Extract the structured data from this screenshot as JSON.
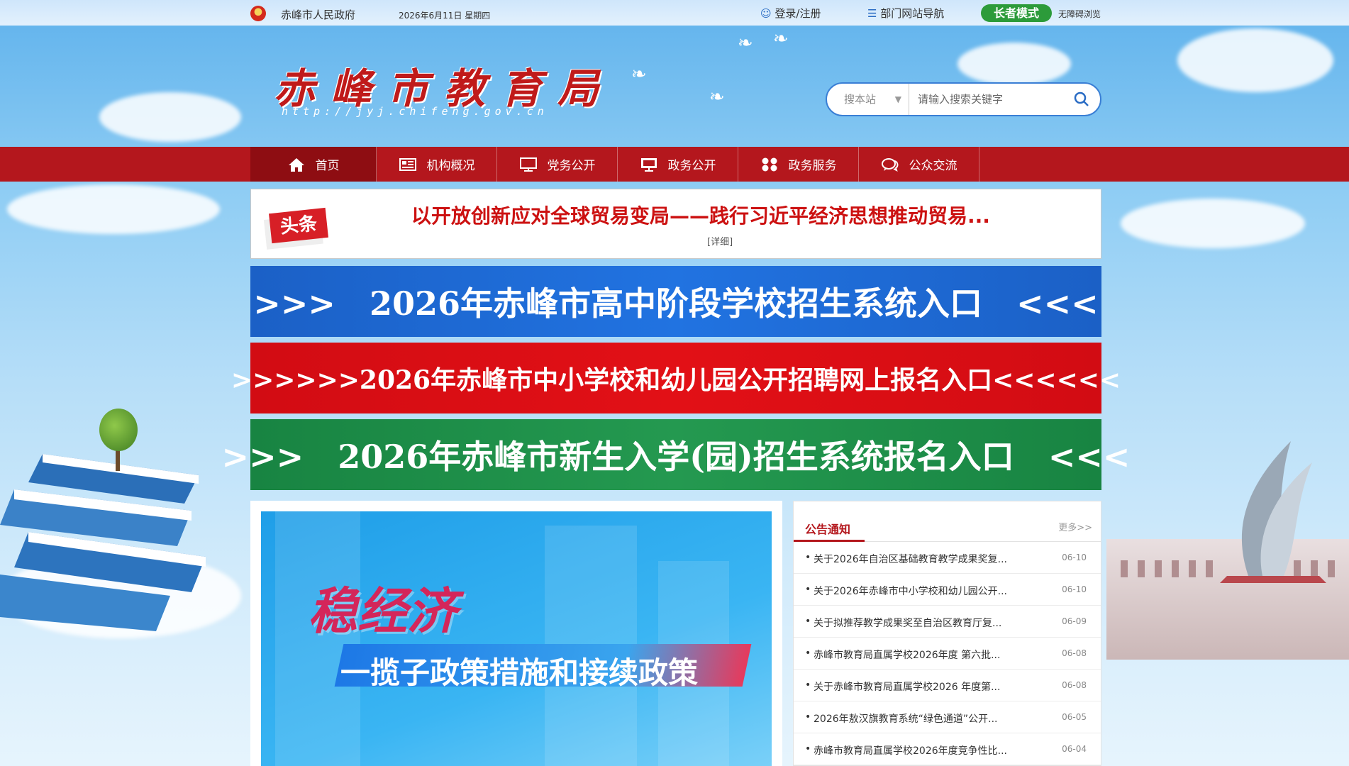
{
  "topbar": {
    "gov_name": "赤峰市人民政府",
    "date": "2026年6月11日 星期四",
    "login": "登录/注册",
    "nav_guide": "部门网站导航",
    "elder_mode": "长者模式",
    "barrier_free": "无障碍浏览"
  },
  "header": {
    "title": "赤峰市教育局",
    "url": "http://jyj.chifeng.gov.cn",
    "search_scope": "搜本站",
    "search_placeholder": "请输入搜索关键字"
  },
  "nav": {
    "items": [
      {
        "label": "首页",
        "icon": "home-icon"
      },
      {
        "label": "机构概况",
        "icon": "newspaper-icon"
      },
      {
        "label": "党务公开",
        "icon": "monitor-icon"
      },
      {
        "label": "政务公开",
        "icon": "display-icon"
      },
      {
        "label": "政务服务",
        "icon": "grid-icon"
      },
      {
        "label": "公众交流",
        "icon": "chat-icon"
      }
    ]
  },
  "headline": {
    "badge": "头条",
    "title": "以开放创新应对全球贸易变局——践行习近平经济思想推动贸易...",
    "more": "[详细]"
  },
  "entries": [
    {
      "text": ">>>   2026年赤峰市高中阶段学校招生系统入口   <<<",
      "color": "#1f6ad6"
    },
    {
      "text": ">>>>>>2026年赤峰市中小学校和幼儿园公开招聘网上报名入口<<<<<<",
      "color": "#de0f15"
    },
    {
      "text": ">>>   2026年赤峰市新生入学(园)招生系统报名入口   <<<",
      "color": "#219048"
    }
  ],
  "slide": {
    "big": "稳经济",
    "sub": "一揽子政策措施和接续政策"
  },
  "notices": {
    "title": "公告通知",
    "more": "更多>>",
    "items": [
      {
        "text": "关于2026年自治区基础教育教学成果奖复...",
        "date": "06-10"
      },
      {
        "text": "关于2026年赤峰市中小学校和幼儿园公开...",
        "date": "06-10"
      },
      {
        "text": "关于拟推荐教学成果奖至自治区教育厅复...",
        "date": "06-09"
      },
      {
        "text": "赤峰市教育局直属学校2026年度 第六批...",
        "date": "06-08"
      },
      {
        "text": "关于赤峰市教育局直属学校2026 年度第...",
        "date": "06-08"
      },
      {
        "text": "2026年敖汉旗教育系统“绿色通道”公开...",
        "date": "06-05"
      },
      {
        "text": "赤峰市教育局直属学校2026年度竞争性比...",
        "date": "06-04"
      }
    ]
  }
}
